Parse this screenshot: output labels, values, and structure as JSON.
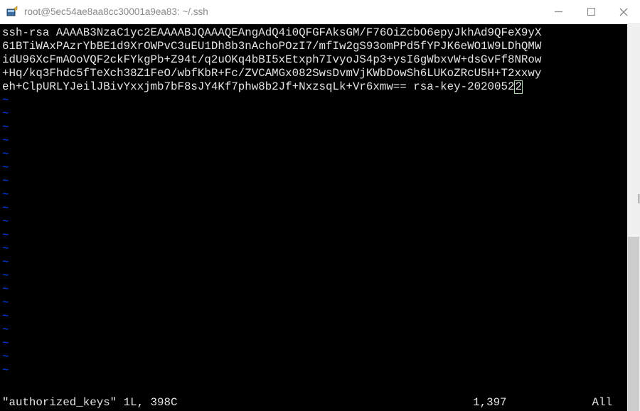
{
  "window": {
    "title": "root@5ec54ae8aa8cc30001a9ea83: ~/.ssh"
  },
  "terminal": {
    "lines": [
      "ssh-rsa AAAAB3NzaC1yc2EAAAABJQAAAQEAngAdQ4i0QFGFAksGM/F76OiZcbO6epyJkhAd9QFeX9yX",
      "61BTiWAxPAzrYbBE1d9XrOWPvC3uEU1Dh8b3nAchoPOzI7/mfIw2gS93omPPd5fYPJK6eWO1W9LDhQMW",
      "idU96XcFmAOoVQF2ckFYkgPb+Z94t/q2uOKq4bBI5xEtxph7IvyoJS4p3+ysI6gWbxvW+dsGvFf8NRow",
      "+Hq/kq3Fhdc5fTeXch38Z1FeO/wbfKbR+Fc/ZVCAMGx082SwsDvmVjKWbDowSh6LUKoZRcU5H+T2xxwy",
      "eh+ClpURLYJeilJBivYxxjmb7bF8sJY4Kf7phw8b2Jf+NxzsqLk+Vr6xmw== rsa-key-2020052"
    ],
    "cursor_char": "2",
    "tilde_count": 21
  },
  "status": {
    "left": "\"authorized_keys\" 1L, 398C",
    "position": "1,397",
    "view": "All"
  }
}
